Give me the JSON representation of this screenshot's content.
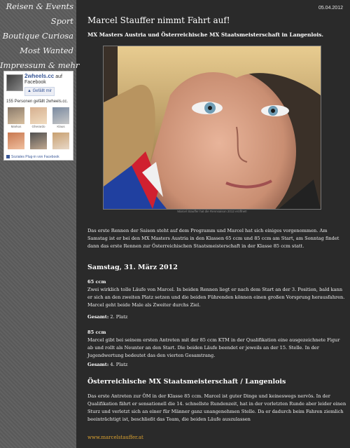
{
  "nav": {
    "items": [
      "Reisen & Events",
      "Sport",
      "Boutique Curiosa",
      "Most Wanted",
      "Impressum & mehr"
    ]
  },
  "facebook": {
    "page_name": "2wheels.cc",
    "on_text": "auf",
    "platform": "Facebook",
    "like_button": "Gefällt mir",
    "likes_count_text": "155 Personen gefällt 2wheels.cc.",
    "faces": [
      "Markus",
      "Gherardo",
      "Klaus",
      "",
      "",
      ""
    ],
    "plugin_text": "Soziales Plug-in von Facebook"
  },
  "article": {
    "date": "05.04.2012",
    "title": "Marcel Stauffer nimmt Fahrt auf!",
    "subtitle": "MX Masters Austria und Österreichische MX Staatsmeisterschaft in Langenlois.",
    "photo_caption": "Marcel Stauffer hat die Rennsaison 2012 eröffnet!",
    "intro": "Das erste Rennen der Saison steht auf dem Programm und Marcel hat sich einiges vorgenommen. Am Samstag ist er bei den MX Masters Austria in den Klassen 65 ccm und 85 ccm am Start, am Sonntag findet dann das erste Rennen zur Österreichischen Staatsmeisterschaft in der Klasse 85 ccm statt.",
    "section1_heading": "Samstag, 31. März 2012",
    "class1_label": "65 ccm",
    "class1_text": "Zwei wirklich tolle Läufe von Marcel. In beiden Rennen liegt er nach dem Start an der 3. Position, bald kann er sich an den zweiten Platz setzen und die beiden Führenden können einen großen Vorsprung herausfahren. Marcel geht beide Male als Zweiter durchs Ziel.",
    "class1_result_label": "Gesamt:",
    "class1_result_value": "2. Platz",
    "class2_label": "85 ccm",
    "class2_text": "Marcel gibt bei seinem ersten Antreten mit der 85 ccm KTM in der Qualifikation eine ausgezeichnete Figur ab und rollt als Neunter an den Start. Die beiden Läufe beendet er jeweils an der 15. Stelle. In der Jugendwertung bedeutet das den vierten Gesamtrang.",
    "class2_result_label": "Gesamt:",
    "class2_result_value": "4. Platz",
    "section2_heading": "Österreichische MX Staatsmeisterschaft / Langenlois",
    "section2_text": "Das erste Antreten zur ÖM in der Klasse 85 ccm. Marcel ist guter Dinge und keineswegs nervös. In der Qualifikation fährt er sensationell die 14. schnellste Rundenzeit, hat in der vorletzten Runde aber leider einen Sturz und verletzt sich an einer für Männer ganz unangenehmen Stelle. Da er dadurch beim Fahren ziemlich beeinträchtigt ist, beschließt das Team, die beiden Läufe auszulassen",
    "footer_link": "www.marcelstauffer.at"
  },
  "colors": {
    "page_bg": "#2a2a2a",
    "sidebar_bg": "#5c5c5c",
    "link_color": "#d9a030",
    "fb_blue": "#3b5998"
  }
}
